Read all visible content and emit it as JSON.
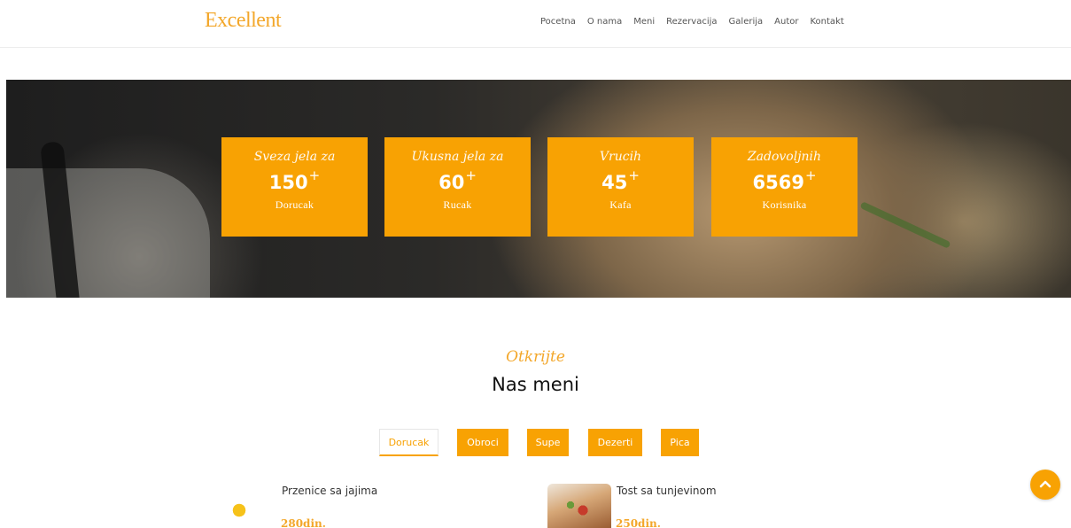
{
  "header": {
    "logo": "Excellent",
    "nav": [
      "Pocetna",
      "O nama",
      "Meni",
      "Rezervacija",
      "Galerija",
      "Autor",
      "Kontakt"
    ]
  },
  "stats": [
    {
      "script": "Sveza jela za",
      "number": "150",
      "suffix": "+",
      "label": "Dorucak"
    },
    {
      "script": "Ukusna jela za",
      "number": "60",
      "suffix": "+",
      "label": "Rucak"
    },
    {
      "script": "Vrucih",
      "number": "45",
      "suffix": "+",
      "label": "Kafa"
    },
    {
      "script": "Zadovoljnih",
      "number": "6569",
      "suffix": "+",
      "label": "Korisnika"
    }
  ],
  "menu_section": {
    "script_title": "Otkrijte",
    "title": "Nas meni",
    "tabs": [
      {
        "label": "Dorucak",
        "active": true
      },
      {
        "label": "Obroci",
        "active": false
      },
      {
        "label": "Supe",
        "active": false
      },
      {
        "label": "Dezerti",
        "active": false
      },
      {
        "label": "Pica",
        "active": false
      }
    ],
    "items": [
      {
        "name": "Przenice sa jajima",
        "price": "280din.",
        "image": "eggs-photo"
      },
      {
        "name": "Tost sa tunjevinom",
        "price": "250din.",
        "image": "toast-photo"
      }
    ]
  },
  "back_to_top": {
    "icon": "chevron-up-icon",
    "glyph": "^"
  },
  "colors": {
    "accent": "#f8a203",
    "logo": "#f3a72a"
  }
}
